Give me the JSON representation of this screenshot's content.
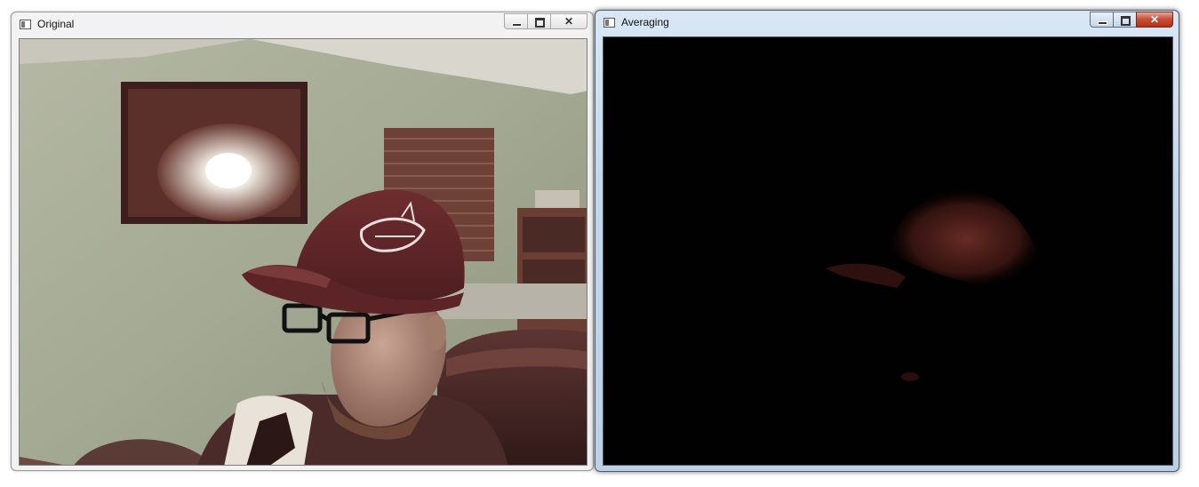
{
  "windows": [
    {
      "title": "Original",
      "buttons": {
        "minimize": "minimize-button",
        "maximize": "maximize-button",
        "close": "close-button"
      },
      "content": "webcam frame: man in maroon baseball cap and black glasses in a room with a framed picture, window blinds and bookshelf"
    },
    {
      "title": "Averaging",
      "buttons": {
        "minimize": "minimize-button",
        "maximize": "maximize-button",
        "close": "close-button"
      },
      "content": "running-average frame: mostly black with faint reddish silhouette of cap"
    }
  ],
  "colors": {
    "inactive_frame": "#f2f2f2",
    "active_frame": "#c3d6ea",
    "close_button_active": "#c8513a",
    "cap": "#6b2a2a",
    "averaging_background": "#020101"
  }
}
